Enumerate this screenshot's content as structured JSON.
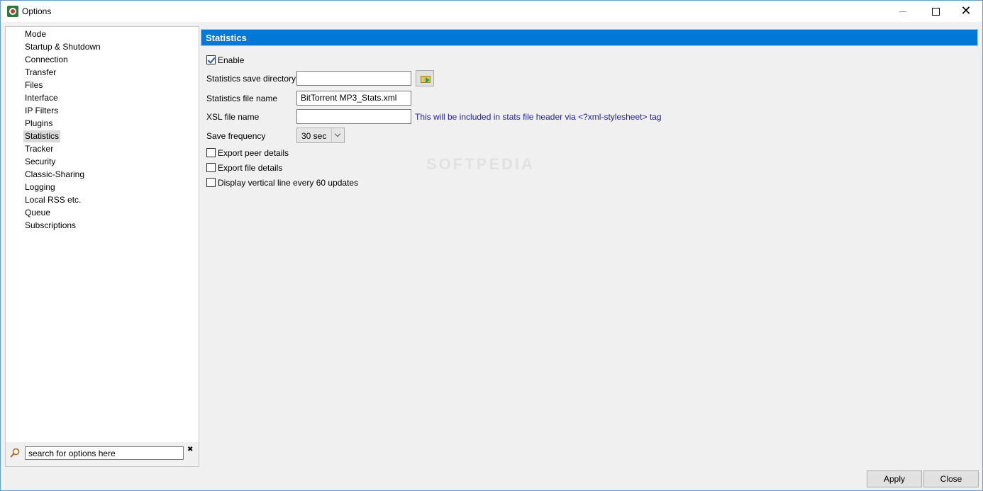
{
  "window": {
    "title": "Options",
    "minimize_icon": "minimize-icon",
    "maximize_icon": "maximize-icon",
    "close_icon": "close-icon"
  },
  "sidebar": {
    "items": [
      {
        "label": "Mode"
      },
      {
        "label": "Startup & Shutdown"
      },
      {
        "label": "Connection"
      },
      {
        "label": "Transfer"
      },
      {
        "label": "Files"
      },
      {
        "label": "Interface"
      },
      {
        "label": "IP Filters"
      },
      {
        "label": "Plugins"
      },
      {
        "label": "Statistics",
        "selected": true
      },
      {
        "label": "Tracker"
      },
      {
        "label": "Security"
      },
      {
        "label": "Classic-Sharing"
      },
      {
        "label": "Logging"
      },
      {
        "label": "Local RSS etc."
      },
      {
        "label": "Queue"
      },
      {
        "label": "Subscriptions"
      }
    ],
    "search": {
      "value": "search for options here",
      "icon": "search-icon",
      "clear_icon": "clear-icon"
    }
  },
  "main": {
    "section_title": "Statistics",
    "enable": {
      "label": "Enable",
      "checked": true
    },
    "save_directory": {
      "label": "Statistics save directory",
      "value": "",
      "browse_icon": "folder-icon"
    },
    "file_name": {
      "label": "Statistics file name",
      "value": "BitTorrent MP3_Stats.xml"
    },
    "xsl_file": {
      "label": "XSL file name",
      "value": "",
      "hint": "This will be included in stats file header via <?xml-stylesheet> tag"
    },
    "save_frequency": {
      "label": "Save frequency",
      "value": "30 sec"
    },
    "export_peer": {
      "label": "Export peer details",
      "checked": false
    },
    "export_file": {
      "label": "Export file details",
      "checked": false
    },
    "vertical_line": {
      "label": "Display vertical line every 60 updates",
      "checked": false
    }
  },
  "footer": {
    "apply_label": "Apply",
    "close_label": "Close"
  },
  "colors": {
    "accent": "#0078d7",
    "hint_text": "#1f1f9f"
  }
}
